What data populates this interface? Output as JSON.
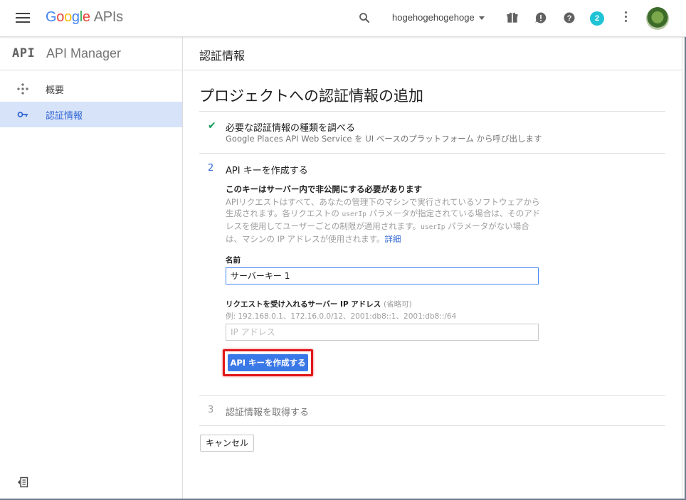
{
  "topbar": {
    "logo_google": [
      "G",
      "o",
      "o",
      "g",
      "l",
      "e"
    ],
    "logo_apis": "APIs",
    "project_name": "hogehogehogehoge",
    "notification_count": "2"
  },
  "sidebar": {
    "api_mark": "API",
    "title": "API Manager",
    "items": [
      {
        "label": "概要",
        "icon": "overview-icon"
      },
      {
        "label": "認証情報",
        "icon": "key-icon"
      }
    ]
  },
  "page": {
    "header": "認証情報",
    "heading": "プロジェクトへの認証情報の追加"
  },
  "steps": {
    "s1": {
      "title": "必要な認証情報の種類を調べる",
      "subtitle": "Google Places API Web Service を UI ベースのプラットフォーム から呼び出します"
    },
    "s2": {
      "number": "2",
      "title": "API キーを作成する",
      "warning": "このキーはサーバー内で非公開にする必要があります",
      "desc_1": "APIリクエストはすべて、あなたの管理下のマシンで実行されているソフトウェアから生成されます。各リクエストの ",
      "code_1": "userIp",
      "desc_2": " パラメータが指定されている場合は、そのアドレスを使用してユーザーごとの制限が適用されます。",
      "code_2": "userIp",
      "desc_3": " パラメータがない場合は、マシンの IP アドレスが使用されます。",
      "link": "詳細",
      "name_label": "名前",
      "name_value": "サーバーキー 1",
      "ip_label": "リクエストを受け入れるサーバー IP アドレス",
      "ip_optional": "(省略可)",
      "ip_hint": "例: 192.168.0.1、172.16.0.0/12、2001:db8::1、2001:db8::/64",
      "ip_placeholder": "IP アドレス",
      "create_button": "API キーを作成する"
    },
    "s3": {
      "number": "3",
      "title": "認証情報を取得する"
    }
  },
  "cancel_button": "キャンセル",
  "colors": {
    "primary": "#3b78e7",
    "highlight_box": "#e0171b",
    "sidebar_active": "#d7e3f8",
    "check": "#0f9d58"
  }
}
